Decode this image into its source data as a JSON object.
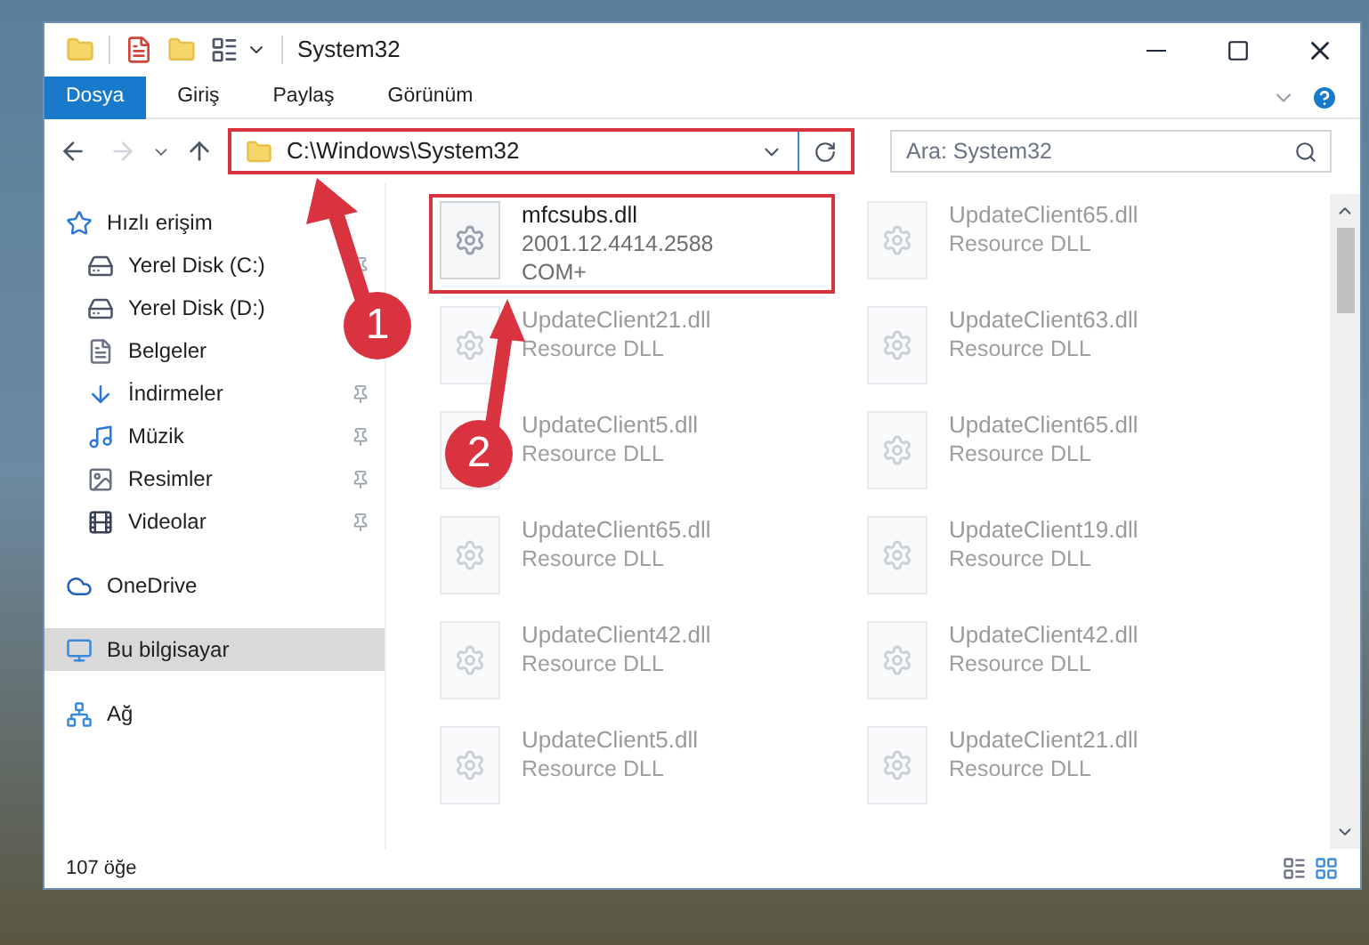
{
  "window": {
    "title": "System32"
  },
  "ribbon_tabs": [
    {
      "label": "Dosya",
      "selected": true
    },
    {
      "label": "Giriş",
      "selected": false
    },
    {
      "label": "Paylaş",
      "selected": false
    },
    {
      "label": "Görünüm",
      "selected": false
    }
  ],
  "address_bar": {
    "path": "C:\\Windows\\System32",
    "highlighted": true
  },
  "search": {
    "placeholder": "Ara: System32"
  },
  "sidebar": {
    "items": [
      {
        "label": "Hızlı erişim",
        "selected": false,
        "pinned": false,
        "children": [
          {
            "label": "Yerel Disk (C:)",
            "selected": false,
            "pinned": true
          },
          {
            "label": "Yerel Disk (D:)",
            "selected": false,
            "pinned": false
          },
          {
            "label": "Belgeler",
            "selected": false,
            "pinned": false
          },
          {
            "label": "İndirmeler",
            "selected": false,
            "pinned": true
          },
          {
            "label": "Müzik",
            "selected": false,
            "pinned": true
          },
          {
            "label": "Resimler",
            "selected": false,
            "pinned": true
          },
          {
            "label": "Videolar",
            "selected": false,
            "pinned": true
          }
        ]
      },
      {
        "label": "OneDrive",
        "selected": false,
        "pinned": false
      },
      {
        "label": "Bu bilgisayar",
        "selected": true,
        "pinned": false
      },
      {
        "label": "Ağ",
        "selected": false,
        "pinned": false
      }
    ]
  },
  "files": [
    {
      "name": "mfcsubs.dll",
      "lines": [
        "2001.12.4414.2588",
        "COM+"
      ],
      "highlighted": true
    },
    {
      "name": "UpdateClient65.dll",
      "lines": [
        "Resource DLL"
      ],
      "highlighted": false
    },
    {
      "name": "UpdateClient21.dll",
      "lines": [
        "Resource DLL"
      ],
      "highlighted": false
    },
    {
      "name": "UpdateClient63.dll",
      "lines": [
        "Resource DLL"
      ],
      "highlighted": false
    },
    {
      "name": "UpdateClient5.dll",
      "lines": [
        "Resource DLL"
      ],
      "highlighted": false
    },
    {
      "name": "UpdateClient65.dll",
      "lines": [
        "Resource DLL"
      ],
      "highlighted": false
    },
    {
      "name": "UpdateClient65.dll",
      "lines": [
        "Resource DLL"
      ],
      "highlighted": false
    },
    {
      "name": "UpdateClient19.dll",
      "lines": [
        "Resource DLL"
      ],
      "highlighted": false
    },
    {
      "name": "UpdateClient42.dll",
      "lines": [
        "Resource DLL"
      ],
      "highlighted": false
    },
    {
      "name": "UpdateClient42.dll",
      "lines": [
        "Resource DLL"
      ],
      "highlighted": false
    },
    {
      "name": "UpdateClient5.dll",
      "lines": [
        "Resource DLL"
      ],
      "highlighted": false
    },
    {
      "name": "UpdateClient21.dll",
      "lines": [
        "Resource DLL"
      ],
      "highlighted": false
    }
  ],
  "status_bar": {
    "item_count": "107 öğe"
  },
  "annotations": [
    "1",
    "2"
  ]
}
